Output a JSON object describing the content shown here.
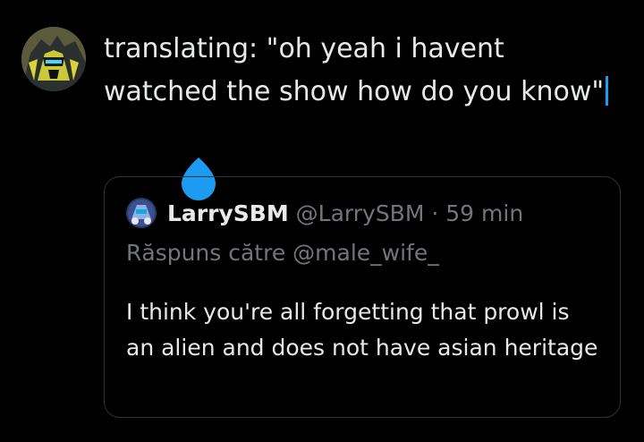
{
  "tweet": {
    "text": "translating: \"oh yeah i havent watched the show how do you know\"",
    "author_avatar_icon": "author-avatar"
  },
  "quote": {
    "display_name": "LarrySBM",
    "handle": "@LarrySBM",
    "separator": "·",
    "time": "59 min",
    "reply_to": "Răspuns către @male_wife_",
    "text": "I think you're all forgetting that prowl is an alien and does not have asian heritage"
  },
  "colors": {
    "background": "#000000",
    "text": "#e7e9ea",
    "secondary_text": "#71767b",
    "border": "#2f3336",
    "selection_accent": "#1d9bf0"
  }
}
